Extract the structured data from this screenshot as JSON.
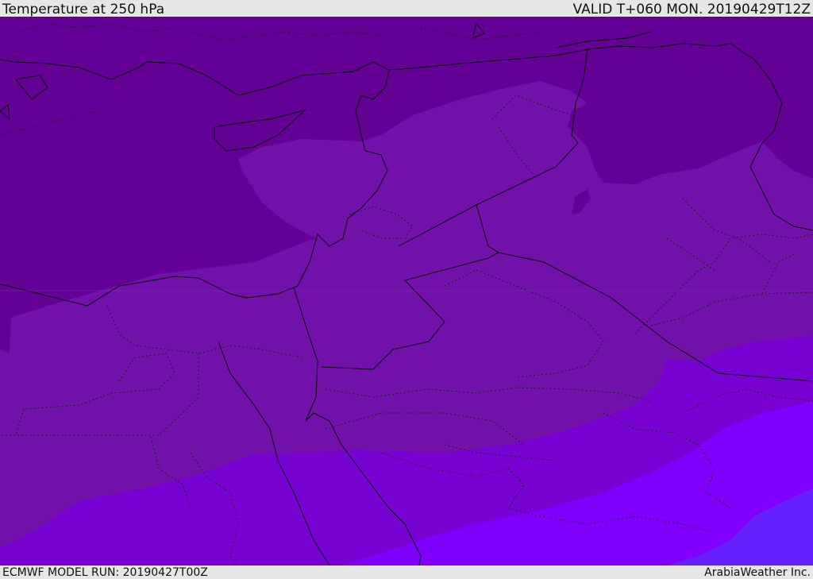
{
  "header": {
    "title": "Temperature at 250 hPa",
    "valid_time": "VALID T+060 MON. 20190429T12Z"
  },
  "footer": {
    "model_run": "ECMWF MODEL RUN: 20190427T00Z",
    "credit": "ArabiaWeather Inc."
  },
  "colors": {
    "band_coldest": "#640096",
    "band_cold": "#7210aa",
    "band_mid": "#7700d2",
    "band_warm": "#7f00ff",
    "band_warmest": "#6422ff",
    "coastline": "#000000",
    "border_dotted": "#1a1a1a",
    "frame": "#e6e6e6"
  }
}
